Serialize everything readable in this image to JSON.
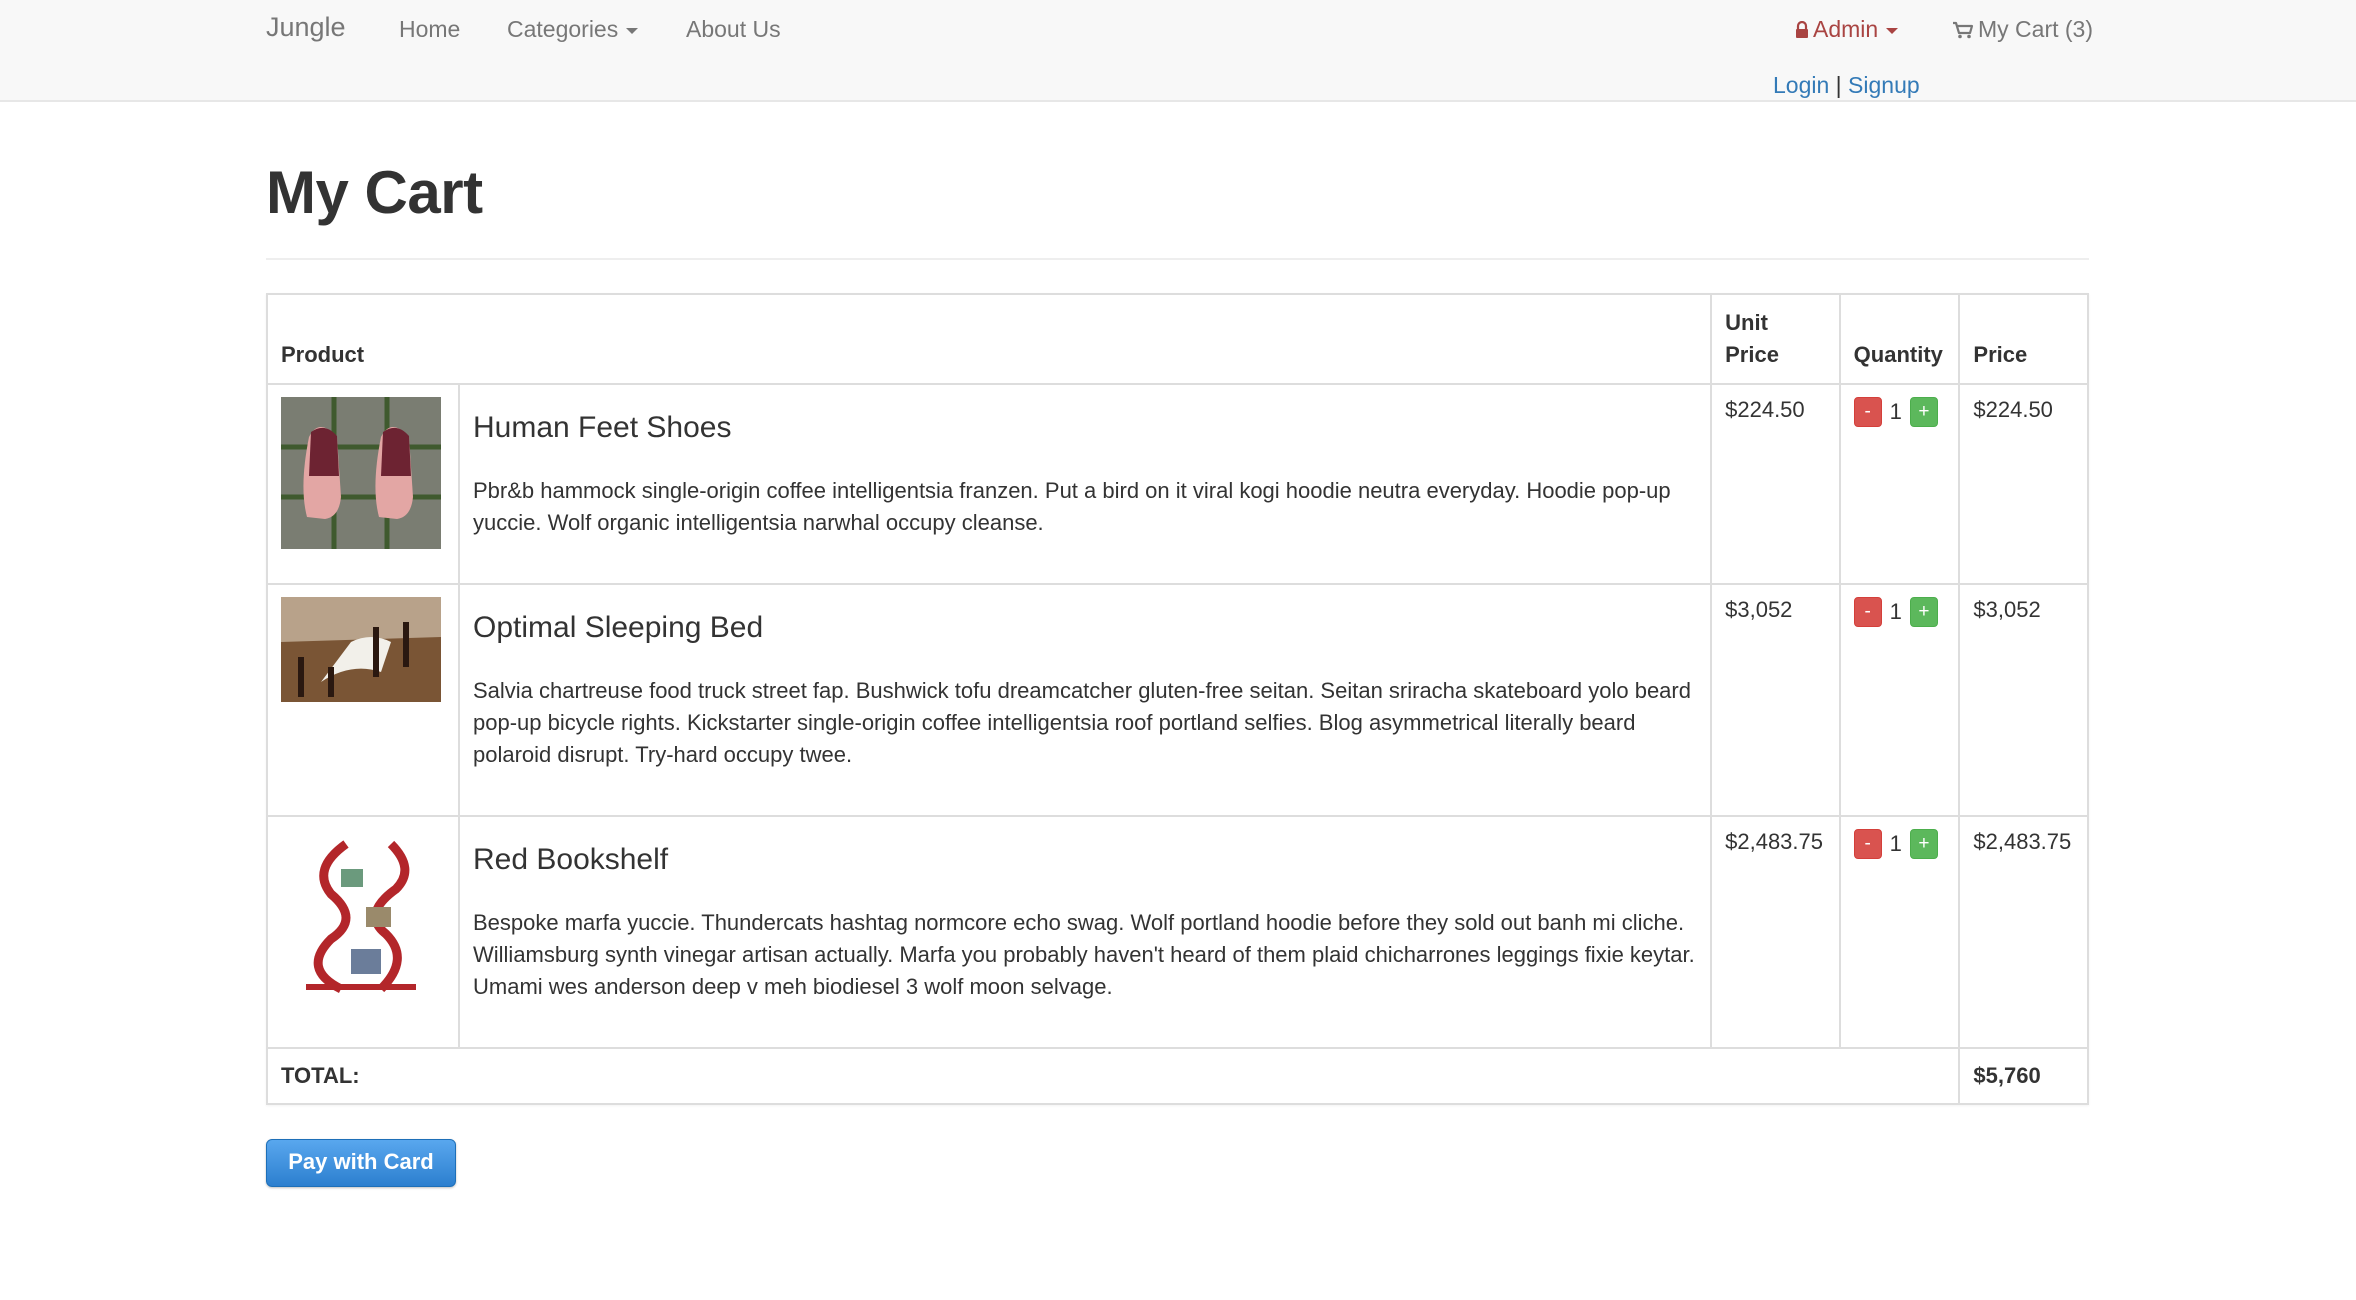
{
  "navbar": {
    "brand": "Jungle",
    "links": [
      "Home",
      "Categories",
      "About Us"
    ],
    "admin_label": "Admin",
    "cart_label": "My Cart (3)",
    "login": "Login",
    "separator": "|",
    "signup": "Signup"
  },
  "page": {
    "title": "My Cart"
  },
  "table": {
    "headers": {
      "product": "Product",
      "unit_price": "Unit Price",
      "quantity": "Quantity",
      "price": "Price"
    },
    "rows": [
      {
        "name": "Human Feet Shoes",
        "description": "Pbr&b hammock single-origin coffee intelligentsia franzen. Put a bird on it viral kogi hoodie neutra everyday. Hoodie pop-up yuccie. Wolf organic intelligentsia narwhal occupy cleanse.",
        "unit_price": "$224.50",
        "quantity": "1",
        "price": "$224.50"
      },
      {
        "name": "Optimal Sleeping Bed",
        "description": "Salvia chartreuse food truck street fap. Bushwick tofu dreamcatcher gluten-free seitan. Seitan sriracha skateboard yolo beard pop-up bicycle rights. Kickstarter single-origin coffee intelligentsia roof portland selfies. Blog asymmetrical literally beard polaroid disrupt. Try-hard occupy twee.",
        "unit_price": "$3,052",
        "quantity": "1",
        "price": "$3,052"
      },
      {
        "name": "Red Bookshelf",
        "description": "Bespoke marfa yuccie. Thundercats hashtag normcore echo swag. Wolf portland hoodie before they sold out banh mi cliche. Williamsburg synth vinegar artisan actually. Marfa you probably haven't heard of them plaid chicharrones leggings fixie keytar. Umami wes anderson deep v meh biodiesel 3 wolf moon selvage.",
        "unit_price": "$2,483.75",
        "quantity": "1",
        "price": "$2,483.75"
      }
    ],
    "minus_label": "-",
    "plus_label": "+",
    "total_label": "TOTAL:",
    "total_value": "$5,760"
  },
  "pay_button": "Pay with Card"
}
